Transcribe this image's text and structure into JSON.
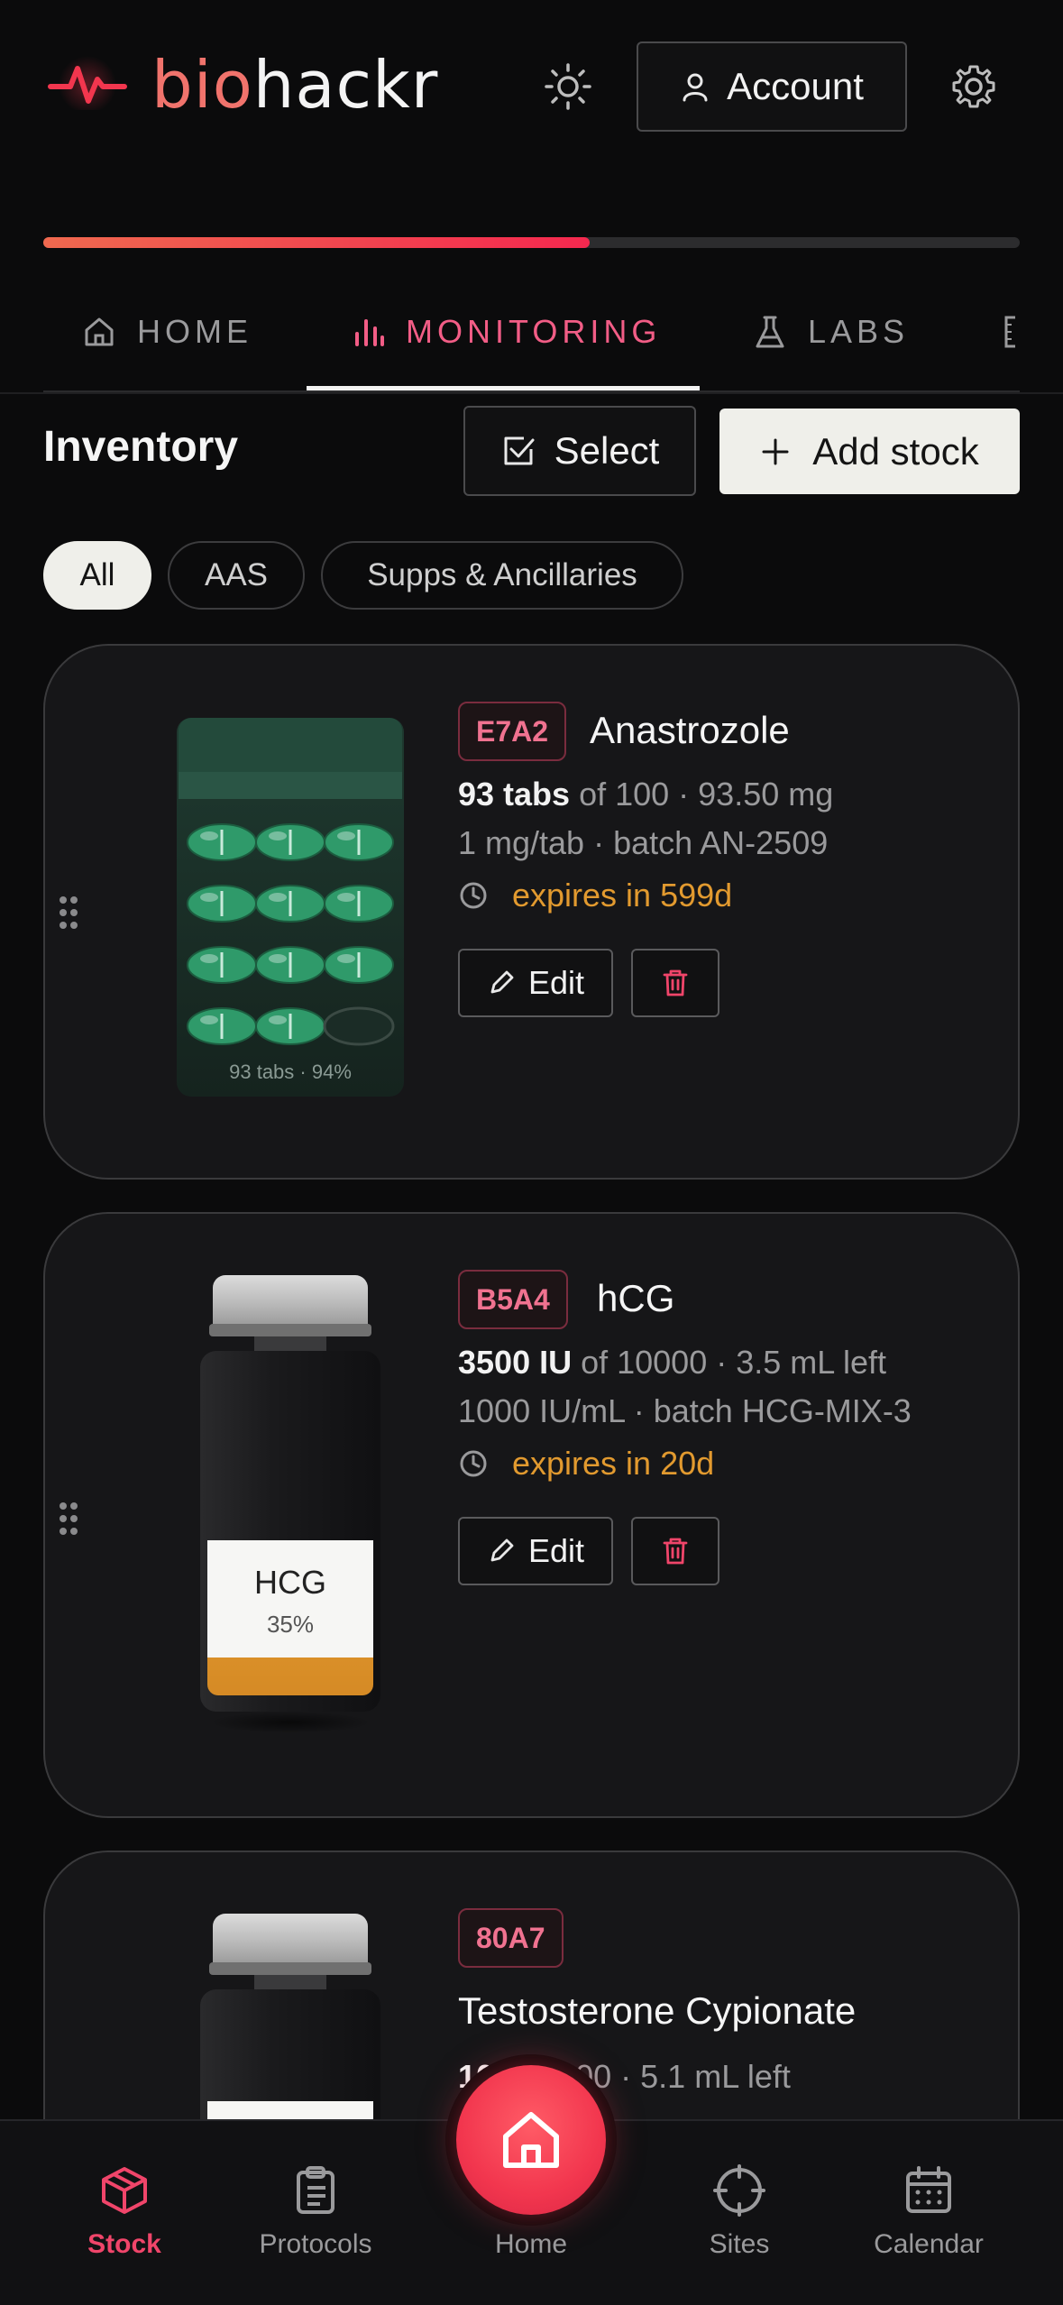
{
  "header": {
    "logo_bio": "bio",
    "logo_hackr": "hackr",
    "account_label": "Account",
    "progress": 0.56
  },
  "tabs": [
    {
      "label": "HOME",
      "icon": "home-icon"
    },
    {
      "label": "MONITORING",
      "icon": "bar-chart-icon",
      "active": true
    },
    {
      "label": "LABS",
      "icon": "flask-icon"
    }
  ],
  "inventory": {
    "title": "Inventory",
    "select_label": "Select",
    "add_label": "Add stock"
  },
  "filters": [
    "All",
    "AAS",
    "Supps & Ancillaries"
  ],
  "items": [
    {
      "code": "E7A2",
      "name": "Anastrozole",
      "amount": "93 tabs",
      "rest": " of 100 · 93.50 mg",
      "detail": "1 mg/tab · batch AN-2509",
      "expiry": "expires in 599d",
      "visual_caption": "93 tabs · 94%",
      "edit_label": "Edit"
    },
    {
      "code": "B5A4",
      "name": "hCG",
      "amount": "3500 IU",
      "rest": " of 10000 · 3.5 mL left",
      "detail": "1000 IU/mL · batch HCG-MIX-3",
      "expiry": "expires in 20d",
      "vial_label": "HCG",
      "vial_pct": "35%",
      "fill": 0.35,
      "edit_label": "Edit"
    },
    {
      "code": "80A7",
      "name": "Testosterone Cypionate",
      "amount": "10",
      "rest": " of 2000 · 5.1 mL left"
    }
  ],
  "bottom_nav": {
    "stock": "Stock",
    "protocols": "Protocols",
    "home": "Home",
    "sites": "Sites",
    "calendar": "Calendar"
  },
  "colors": {
    "accent": "#f25d86",
    "brand_red": "#f2364e",
    "expiry": "#e29a2f",
    "pill_green": "#2f9a6a"
  }
}
